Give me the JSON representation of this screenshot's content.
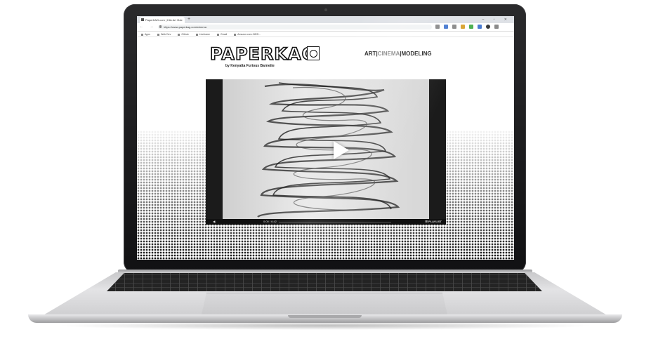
{
  "browser": {
    "tab_title": "PaperKAG.com | Kiln Art Vide",
    "new_tab_symbol": "+",
    "window_controls": "– ▫ ✕",
    "nav_symbols": "← → C",
    "url": "https://www.paperkag.com/cinema",
    "bookmarks": [
      "Apps",
      "Web Dev",
      "Github",
      "Liveframe",
      "Gmail",
      "Amazon.com: 8B/S..."
    ]
  },
  "site": {
    "logo_text": "PAPERKAG",
    "byline": "by Kenyatta Furious Barnette",
    "nav": {
      "art": "ART",
      "sep1": "|",
      "cinema": "CINEMA",
      "sep2": "|",
      "modeling": "MODELING"
    }
  },
  "player": {
    "time": "0:00 / 6:42",
    "playlist_label": "PLAYLIST",
    "volume_icon": "speaker-icon",
    "play_icon": "play-icon"
  },
  "colors": {
    "lid": "#111113",
    "page_bg": "#ffffff",
    "accent_text": "#222222",
    "muted_nav": "#888888",
    "player_bg": "#1b1b1b"
  }
}
